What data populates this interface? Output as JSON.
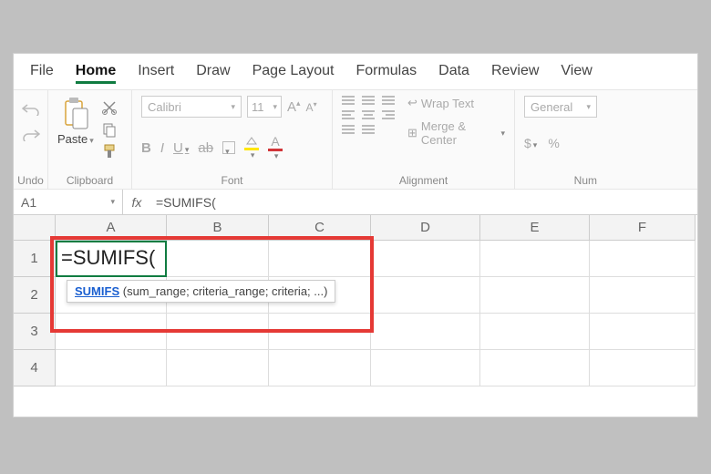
{
  "tabs": {
    "file": "File",
    "home": "Home",
    "insert": "Insert",
    "draw": "Draw",
    "layout": "Page Layout",
    "formulas": "Formulas",
    "data": "Data",
    "review": "Review",
    "view": "View",
    "active": "home"
  },
  "ribbon": {
    "undo_label": "Undo",
    "clipboard": {
      "paste": "Paste",
      "label": "Clipboard"
    },
    "font": {
      "name": "Calibri",
      "size": "11",
      "label": "Font",
      "bold": "B",
      "italic": "I",
      "underline": "U",
      "strike": "ab"
    },
    "alignment": {
      "label": "Alignment",
      "wrap": "Wrap Text",
      "merge": "Merge & Center"
    },
    "number": {
      "label": "Num",
      "format": "General",
      "currency": "$",
      "percent": "%"
    }
  },
  "fxbar": {
    "namebox": "A1",
    "fx": "fx",
    "formula": "=SUMIFS("
  },
  "grid": {
    "cols": [
      "A",
      "B",
      "C",
      "D",
      "E",
      "F"
    ],
    "rows": [
      "1",
      "2",
      "3",
      "4"
    ],
    "active_cell_text": "=SUMIFS("
  },
  "tooltip": {
    "fn": "SUMIFS",
    "sig": " (sum_range; criteria_range; criteria; ...)"
  }
}
